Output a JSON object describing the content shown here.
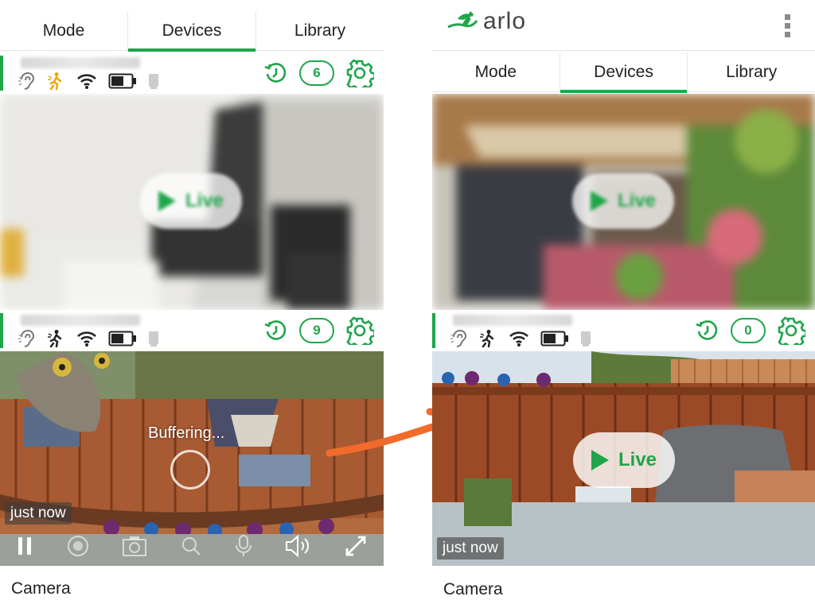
{
  "left": {
    "tabs": [
      {
        "label": "Mode",
        "active": false
      },
      {
        "label": "Devices",
        "active": true
      },
      {
        "label": "Library",
        "active": false
      }
    ],
    "cameras": [
      {
        "clip_count": "6",
        "live_label": "Live"
      },
      {
        "clip_count": "9",
        "buffering_text": "Buffering...",
        "timestamp": "just now"
      }
    ],
    "controls": [
      "pause-icon",
      "record-icon",
      "snapshot-icon",
      "zoom-icon",
      "microphone-icon",
      "speaker-icon",
      "fullscreen-icon"
    ],
    "caption": "Camera"
  },
  "right": {
    "brand": "arlo",
    "tabs": [
      {
        "label": "Mode",
        "active": false
      },
      {
        "label": "Devices",
        "active": true
      },
      {
        "label": "Library",
        "active": false
      }
    ],
    "cameras": [
      {
        "live_label": "Live"
      },
      {
        "clip_count": "0",
        "live_label": "Live",
        "timestamp": "just now"
      }
    ],
    "caption": "Camera"
  },
  "colors": {
    "accent": "#1fa54a",
    "arrow": "#f26b2b"
  }
}
